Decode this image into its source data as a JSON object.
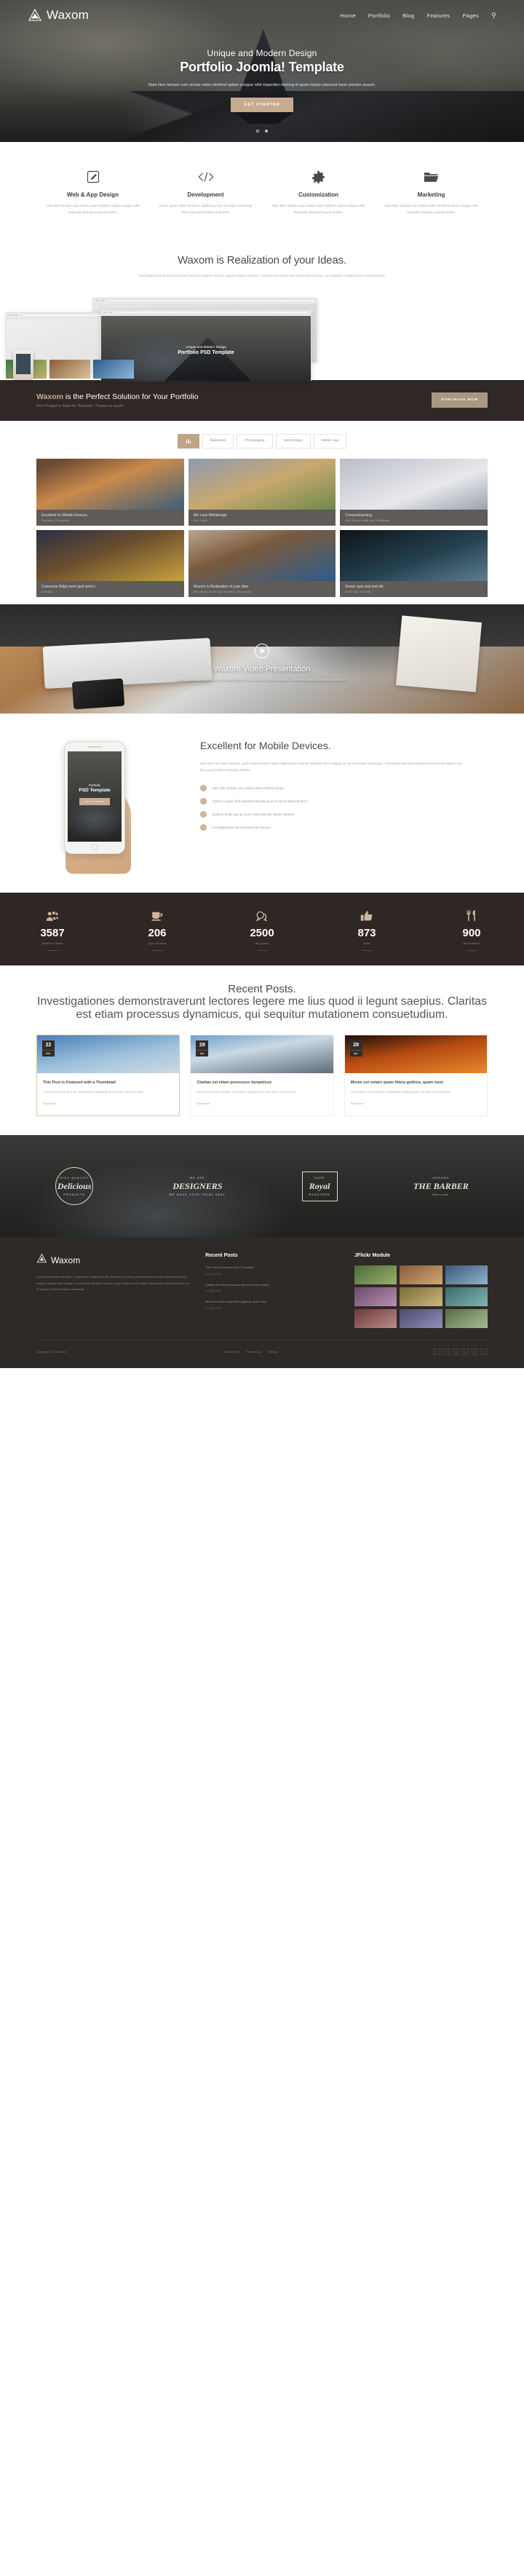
{
  "brand": {
    "name": "Waxom",
    "logo_icon": "triangle-logo-icon"
  },
  "nav": {
    "items": [
      {
        "label": "Home"
      },
      {
        "label": "Portfolio"
      },
      {
        "label": "Blog"
      },
      {
        "label": "Features"
      },
      {
        "label": "Pages"
      }
    ],
    "search_icon": "search-icon"
  },
  "hero": {
    "subtitle": "Unique and Modern Design",
    "title": "Portfolio Joomla! Template",
    "description": "Nam liber tempor cum soluta nobis eleifend option congue nihil imperdiet doming id quod mazim placerat facer possim assum.",
    "cta_label": "GET STARTED",
    "slide_count": 2,
    "active_slide": 2
  },
  "services": [
    {
      "icon": "pencil-square-icon",
      "title": "Web & App Design",
      "text": "Nam liber tempor cum soluta nobis eleifend option congue nihil imperdiet doming id quod mazim."
    },
    {
      "icon": "code-brackets-icon",
      "title": "Development",
      "text": "Lorem ipsum dolor sit amet, adipiscing elit, sed diam nonummy nibh euismod tincidunt ut laoreet."
    },
    {
      "icon": "gear-icon",
      "title": "Customization",
      "text": "Nam liber tempor cum soluta nobis eleifend option congue nihil imperdiet doming id quod mazim."
    },
    {
      "icon": "folder-open-icon",
      "title": "Marketing",
      "text": "Nam liber tempor cum soluta nobis eleifend option congue nihil imperdiet doming id quod mazim."
    }
  ],
  "intro": {
    "heading": "Waxom is Realization of your Ideas.",
    "text": "Investigationes demonstraverunt lectores legere me lius quod ii legunt saepius. Claritas est etiam processus dynamicus, qui sequitur mutationem consuetudium."
  },
  "mockup": {
    "slide_subtitle": "Unique and Modern Design",
    "slide_title": "Portfolio PSD Template",
    "prev_icon": "chevron-left-icon",
    "next_icon": "chevron-right-icon",
    "tab_label": "Our"
  },
  "cta_banner": {
    "title_brand": "Waxom",
    "title_rest": " is the Perfect Solution for Your Portfolio",
    "subtitle": "Don't Forget to Rate the Template. Thanks so much!",
    "button_label": "PURCHASE NOW"
  },
  "portfolio": {
    "filters": [
      {
        "label": "",
        "icon": "grid-icon",
        "active": true
      },
      {
        "label": "Illustration",
        "active": false
      },
      {
        "label": "Photography",
        "active": false
      },
      {
        "label": "Web Design",
        "active": false
      },
      {
        "label": "Mobile App",
        "active": false
      }
    ],
    "items": [
      {
        "title": "Excellent for Mobile Devices.",
        "sub": "Illustration, Photography",
        "like_icon": "heart-icon"
      },
      {
        "title": "We Love Webdesign",
        "sub": "Web Design",
        "like_icon": "heart-icon"
      },
      {
        "title": "Consecteturriing",
        "sub": "Web Design, Mobile App, Photography",
        "like_icon": "heart-icon"
      },
      {
        "title": "Consectur AdipLorem ipsit amet c",
        "sub": "Illustration",
        "like_icon": "heart-icon"
      },
      {
        "title": "Waxom is Realization of your Idea",
        "sub": "Web Design, Mobile App, Illustration, Photography",
        "like_icon": "heart-icon"
      },
      {
        "title": "Donec quis erat sed elit",
        "sub": "Mobile App, Illustration",
        "like_icon": "heart-icon"
      }
    ]
  },
  "video": {
    "play_icon": "play-icon",
    "title": "Waxom Video Presentation",
    "text": "Investigationes demonstraverunt lectores legere me lius quod ii legunt saepius. Claritas est etiam processus dynamicus."
  },
  "mobile": {
    "phone_subtitle": "Portfolio",
    "phone_title": "PSD Template",
    "phone_button": "GET STARTED",
    "heading": "Excellent for Mobile Devices.",
    "text": "Qisi enim ad minim veniam, quis nostrud exerci tation ullamcorper suscipit lobortis nisl ut aliquip ex ea commodo consequat. Investigationes demonstraverunt lectores legere me lius quod ii legunt saepius claritas.",
    "bullets": [
      "Nam liber tempor cum soluta nobis eleifend option;",
      "Option congue nihil imperdiet doming id quod mazim placerat facer;",
      "Quidem modo typi qui nunc nobis videntur parum claritom;",
      "Investigationes demonstraverunt lectores"
    ],
    "bullet_icon": "chevron-right-circle-icon"
  },
  "counters": [
    {
      "icon": "users-icon",
      "number": "3587",
      "label": "Satisfied Clients"
    },
    {
      "icon": "coffee-cup-icon",
      "number": "206",
      "label": "Cups of coffee"
    },
    {
      "icon": "speech-bubble-icon",
      "number": "2500",
      "label": "Blog posts"
    },
    {
      "icon": "thumbs-up-icon",
      "number": "873",
      "label": "Likes"
    },
    {
      "icon": "fork-knife-icon",
      "number": "900",
      "label": "We launched"
    }
  ],
  "recent_posts": {
    "heading": "Recent Posts.",
    "text": "Investigationes demonstraverunt lectores legere me lius quod ii legunt saepius. Claritas est etiam processus dynamicus, qui sequitur mutationem consuetudium.",
    "items": [
      {
        "day": "22",
        "month": "Mar.",
        "title": "This Post is Featured with a Thumbnail",
        "excerpt": "Lorem ipsum dolor sit amet, consectetuer adipiscing elit, sed diam nonummy nibh.",
        "read_more": "Read More"
      },
      {
        "day": "28",
        "month": "Apr.",
        "title": "Claritas est etiam processus dynamicus",
        "excerpt": "Lorem ipsum dolor sit amet, consectetuer adipiscing elit, sed diam nonummy nibh.",
        "read_more": "Read More"
      },
      {
        "day": "28",
        "month": "Apr.",
        "title": "Mirum est notare quam littera gothica, quam nunc",
        "excerpt": "Lorem ipsum dolor sit amet, consectetuer adipiscing elit, sed diam nonummy nibh.",
        "read_more": "Read More"
      }
    ]
  },
  "badges": [
    {
      "top": "HIGH QUALITY",
      "mid": "Delicious",
      "bottom": "PRODUCTS"
    },
    {
      "top": "WE ARE",
      "mid": "DESIGNERS",
      "bottom": "WE MAKE YOUR IDEAS REAL"
    },
    {
      "top": "CAFE",
      "mid": "Royal",
      "bottom": "ROASTERS"
    },
    {
      "top": "AROUND",
      "mid": "THE BARBER",
      "bottom": "Haircuts"
    }
  ],
  "footer": {
    "about_title": "Waxom",
    "about_text": "Lorem ipsum dolor sit amet, consectetuer adipiscing elit, sed diam nonummy nibh euismod tincidunt ut laoreet dolore magna aliquam erat volutpat. Ut wisi enim ad minim veniam, quis nostrud exerci tation ullamcorper suscipit lobortis nisl ut aliquip ex ea commodo consequat.",
    "recent_posts_title": "Recent Posts",
    "recent_posts": [
      {
        "title": "This Post is Featured with a Thumbnail",
        "date": "on 22 Mar 2015"
      },
      {
        "title": "Claritas est etiam processus dynamicus qui sequitur",
        "date": "on 28 Apr 2015"
      },
      {
        "title": "Mirum est notare quam littera gothica, quam nunc",
        "date": "on 28 Apr 2015"
      }
    ],
    "flickr_title": "JFlickr Module",
    "copyright": "Copyright © 2015 Waxom.",
    "links": [
      {
        "label": "Privacy Policy"
      },
      {
        "label": "Terms of Use"
      },
      {
        "label": "Sitemap"
      }
    ],
    "socials": [
      {
        "icon": "facebook-icon",
        "glyph": "f"
      },
      {
        "icon": "twitter-icon",
        "glyph": "t"
      },
      {
        "icon": "google-plus-icon",
        "glyph": "g"
      },
      {
        "icon": "pinterest-icon",
        "glyph": "p"
      },
      {
        "icon": "linkedin-icon",
        "glyph": "in"
      },
      {
        "icon": "rss-icon",
        "glyph": "r"
      }
    ]
  },
  "colors": {
    "accent": "#c6ab8f",
    "dark": "#2f2724",
    "heart": "#e06b8b"
  }
}
